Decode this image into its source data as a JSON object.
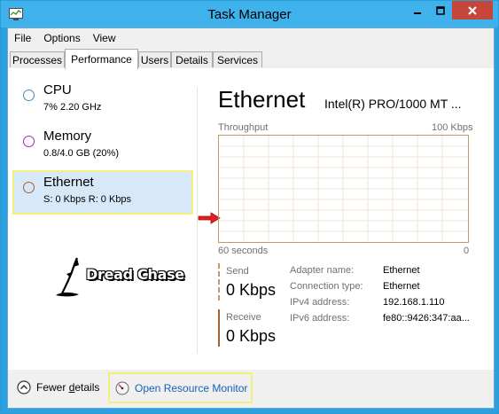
{
  "window": {
    "title": "Task Manager"
  },
  "menu": [
    "File",
    "Options",
    "View"
  ],
  "tabs": [
    {
      "label": "Processes",
      "active": false
    },
    {
      "label": "Performance",
      "active": true
    },
    {
      "label": "Users",
      "active": false
    },
    {
      "label": "Details",
      "active": false
    },
    {
      "label": "Services",
      "active": false
    }
  ],
  "sidebar": {
    "items": [
      {
        "title": "CPU",
        "sub": "7%  2.20 GHz",
        "color": "#3a8fc7"
      },
      {
        "title": "Memory",
        "sub": "0.8/4.0 GB (20%)",
        "color": "#9b2fae"
      },
      {
        "title": "Ethernet",
        "sub": "S: 0 Kbps  R: 0 Kbps",
        "color": "#a0622d",
        "selected": true
      }
    ]
  },
  "watermark": {
    "text": "Dread Chase"
  },
  "detail": {
    "title": "Ethernet",
    "adapter_title": "Intel(R) PRO/1000 MT ...",
    "graph_label": "Throughput",
    "graph_max": "100 Kbps",
    "graph_time": "60 seconds",
    "graph_min": "0",
    "send_label": "Send",
    "send_value": "0 Kbps",
    "receive_label": "Receive",
    "receive_value": "0 Kbps",
    "info": [
      {
        "label": "Adapter name:",
        "value": "Ethernet"
      },
      {
        "label": "Connection type:",
        "value": "Ethernet"
      },
      {
        "label": "IPv4 address:",
        "value": "192.168.1.110"
      },
      {
        "label": "IPv6 address:",
        "value": "fe80::9426:347:aa..."
      }
    ]
  },
  "footer": {
    "fewer_details_prefix": "Fewer ",
    "fewer_details_underlined": "d",
    "fewer_details_suffix": "etails",
    "open_resource_monitor": "Open Resource Monitor"
  },
  "colors": {
    "titlebar": "#3fb2ec",
    "close": "#c7463a",
    "graph_border": "#c19a6b",
    "selection_bg": "#d7e8f9",
    "highlight_box": "#f0f07a",
    "link": "#1a5fb4",
    "arrow": "#e02020"
  }
}
